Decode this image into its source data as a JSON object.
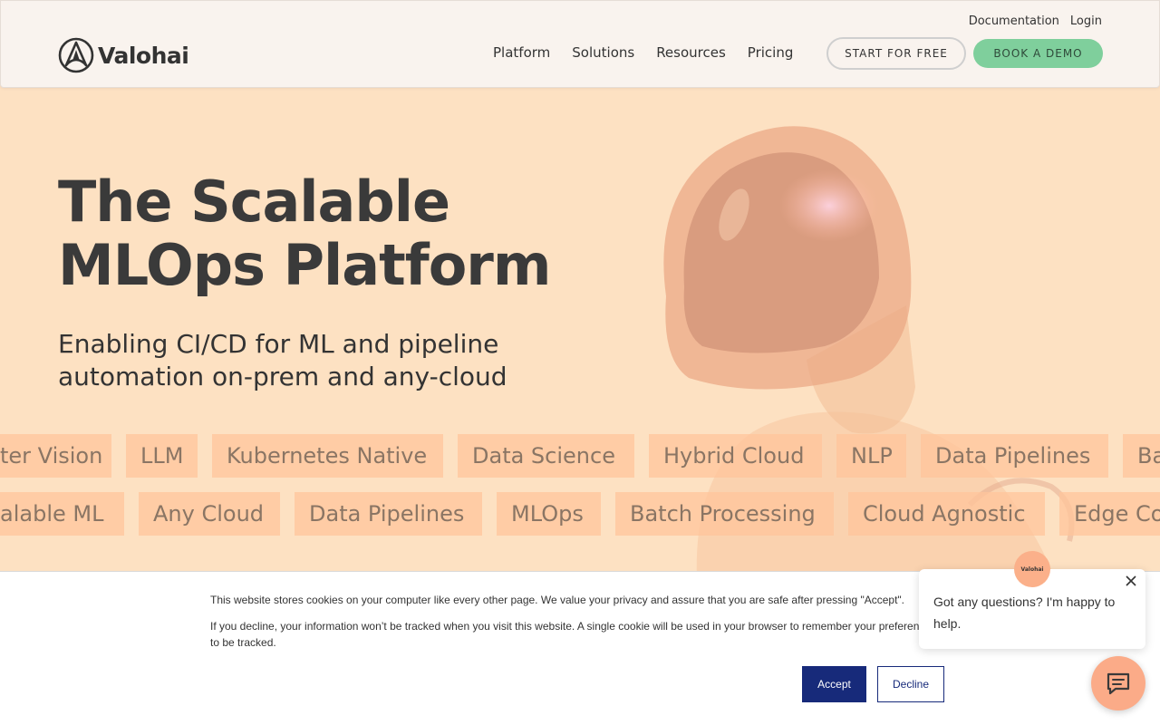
{
  "brand": {
    "name": "Valohai"
  },
  "top_links": [
    {
      "label": "Documentation"
    },
    {
      "label": "Login"
    }
  ],
  "nav": [
    {
      "label": "Platform"
    },
    {
      "label": "Solutions"
    },
    {
      "label": "Resources"
    },
    {
      "label": "Pricing"
    }
  ],
  "cta": {
    "start_free": "START FOR FREE",
    "book_demo": "BOOK A DEMO"
  },
  "hero": {
    "title_line1": "The Scalable",
    "title_line2": "MLOps Platform",
    "subtitle_line1": "Enabling CI/CD for ML and pipeline",
    "subtitle_line2": "automation on-prem and any-cloud"
  },
  "tags_row1": [
    "ter Vision",
    "LLM",
    "Kubernetes Native",
    "Data Science",
    "Hybrid Cloud",
    "NLP",
    "Data Pipelines",
    "Ba"
  ],
  "tags_row2": [
    "alable ML",
    "Any Cloud",
    "Data Pipelines",
    "MLOps",
    "Batch Processing",
    "Cloud Agnostic",
    "Edge Co"
  ],
  "cookie": {
    "line1": "This website stores cookies on your computer like every other page. We value your privacy and assure that you are safe after pressing \"Accept\".",
    "line2": "If you decline, your information won’t be tracked when you visit this website. A single cookie will be used in your browser to remember your preferen",
    "line2_cont": "to be tracked.",
    "accept": "Accept",
    "decline": "Decline"
  },
  "chat": {
    "message": "Got any questions? I'm happy to help.",
    "avatar_text": "Valohai",
    "close_icon": "close-icon",
    "launcher_icon": "chat-icon"
  },
  "colors": {
    "hero_bg": "#fde1c2",
    "demo_button": "#7fcf9c",
    "accept_button": "#172a7a",
    "tag_bg": "#ffc49b"
  }
}
